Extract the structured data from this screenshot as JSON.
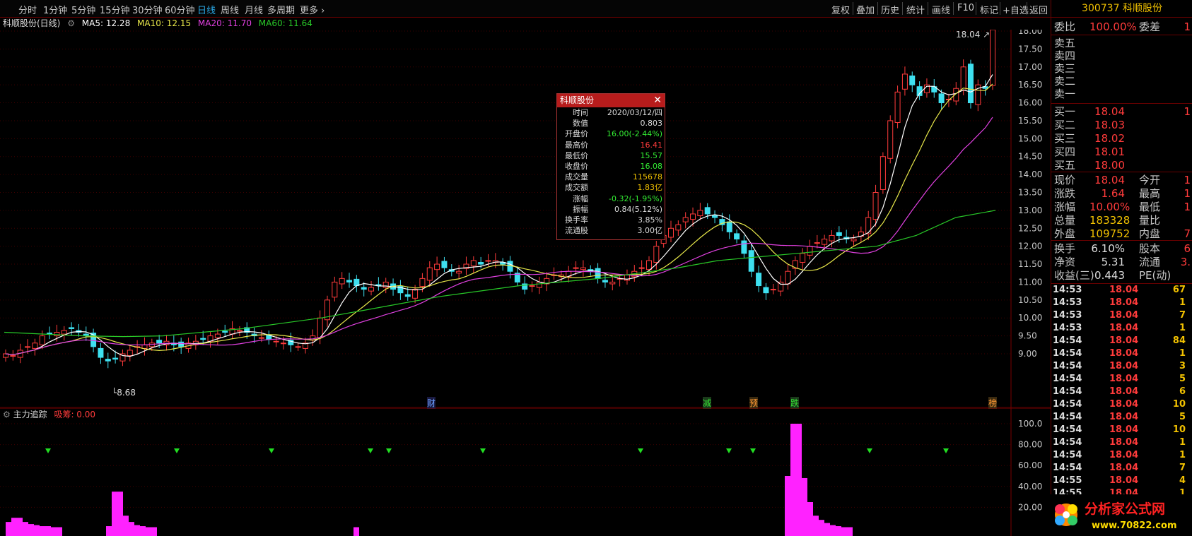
{
  "toolbar": {
    "periods": [
      "分时",
      "1分钟",
      "5分钟",
      "15分钟",
      "30分钟",
      "60分钟",
      "日线",
      "周线",
      "月线",
      "多周期",
      "更多"
    ],
    "active": "日线",
    "right_buttons": [
      "复权",
      "叠加",
      "历史",
      "统计",
      "画线",
      "F10",
      "标记",
      "+自选",
      "返回"
    ]
  },
  "info": {
    "stock": "科顺股份(日线)",
    "ma5": "MA5: 12.28",
    "ma10": "MA10: 12.15",
    "ma20": "MA20: 11.70",
    "ma60": "MA60: 11.64"
  },
  "colors": {
    "up": "#ff3b3b",
    "down": "#3ee0f0",
    "ma5": "#ffffff",
    "ma10": "#e8e84a",
    "ma20": "#e040e0",
    "ma60": "#28c828",
    "indicator": "#ff22ff",
    "signal": "#22dd22"
  },
  "price_axis": [
    "18.00",
    "17.50",
    "17.00",
    "16.50",
    "16.00",
    "15.50",
    "15.00",
    "14.50",
    "14.00",
    "13.50",
    "13.00",
    "12.50",
    "12.00",
    "11.50",
    "11.00",
    "10.50",
    "10.00",
    "9.50",
    "9.00"
  ],
  "annotations": {
    "high": "18.04",
    "low": "8.68"
  },
  "event_markers": [
    "财",
    "减",
    "预",
    "跌",
    "榜"
  ],
  "popup": {
    "title": "科顺股份",
    "rows": [
      {
        "label": "时间",
        "value": "2020/03/12/四",
        "color": "#dddddd"
      },
      {
        "label": "数值",
        "value": "0.803",
        "color": "#dddddd"
      },
      {
        "label": "开盘价",
        "value": "16.00(-2.44%)",
        "color": "#33ee33"
      },
      {
        "label": "最高价",
        "value": "16.41",
        "color": "#ff3b3b"
      },
      {
        "label": "最低价",
        "value": "15.57",
        "color": "#33ee33"
      },
      {
        "label": "收盘价",
        "value": "16.08",
        "color": "#33ee33"
      },
      {
        "label": "成交量",
        "value": "115678",
        "color": "#f0c000"
      },
      {
        "label": "成交额",
        "value": "1.83亿",
        "color": "#f0c000"
      },
      {
        "label": "涨幅",
        "value": "-0.32(-1.95%)",
        "color": "#33ee33"
      },
      {
        "label": "振幅",
        "value": "0.84(5.12%)",
        "color": "#dddddd"
      },
      {
        "label": "换手率",
        "value": "3.85%",
        "color": "#dddddd"
      },
      {
        "label": "流通股",
        "value": "3.00亿",
        "color": "#dddddd"
      }
    ]
  },
  "sub": {
    "name": "主力追踪",
    "value_label": "吸筹: 0.00",
    "axis": [
      "100.0",
      "80.00",
      "60.00",
      "40.00",
      "20.00"
    ]
  },
  "right_panel": {
    "title": "300737 科顺股份",
    "weibi": {
      "label": "委比",
      "value": "100.00%",
      "label2": "委差",
      "value2": "1"
    },
    "asks": [
      {
        "label": "卖五"
      },
      {
        "label": "卖四"
      },
      {
        "label": "卖三"
      },
      {
        "label": "卖二"
      },
      {
        "label": "卖一"
      }
    ],
    "bids": [
      {
        "label": "买一",
        "price": "18.04",
        "vol": "1"
      },
      {
        "label": "买二",
        "price": "18.03",
        "vol": ""
      },
      {
        "label": "买三",
        "price": "18.02",
        "vol": ""
      },
      {
        "label": "买四",
        "price": "18.01",
        "vol": ""
      },
      {
        "label": "买五",
        "price": "18.00",
        "vol": ""
      }
    ],
    "quote": [
      {
        "l": "现价",
        "v": "18.04",
        "l2": "今开",
        "v2": "1"
      },
      {
        "l": "涨跌",
        "v": "1.64",
        "l2": "最高",
        "v2": "1"
      },
      {
        "l": "涨幅",
        "v": "10.00%",
        "l2": "最低",
        "v2": "1"
      },
      {
        "l": "总量",
        "v": "183328",
        "l2": "量比",
        "v2": ""
      },
      {
        "l": "外盘",
        "v": "109752",
        "l2": "内盘",
        "v2": "7"
      }
    ],
    "fund": [
      {
        "l": "换手",
        "v": "6.10%",
        "l2": "股本",
        "v2": "6"
      },
      {
        "l": "净资",
        "v": "5.31",
        "l2": "流通",
        "v2": "3."
      },
      {
        "l": "收益(三)",
        "v": "0.443",
        "l2": "PE(动)",
        "v2": ""
      }
    ],
    "ticks": [
      {
        "t": "14:53",
        "p": "18.04",
        "v": "67",
        "f": "S"
      },
      {
        "t": "14:53",
        "p": "18.04",
        "v": "1",
        "f": "S"
      },
      {
        "t": "14:53",
        "p": "18.04",
        "v": "7",
        "f": "S"
      },
      {
        "t": "14:53",
        "p": "18.04",
        "v": "1",
        "f": "S"
      },
      {
        "t": "14:54",
        "p": "18.04",
        "v": "84",
        "f": "S"
      },
      {
        "t": "14:54",
        "p": "18.04",
        "v": "1",
        "f": "S"
      },
      {
        "t": "14:54",
        "p": "18.04",
        "v": "3",
        "f": "S"
      },
      {
        "t": "14:54",
        "p": "18.04",
        "v": "5",
        "f": "S"
      },
      {
        "t": "14:54",
        "p": "18.04",
        "v": "6",
        "f": "S"
      },
      {
        "t": "14:54",
        "p": "18.04",
        "v": "10",
        "f": "S"
      },
      {
        "t": "14:54",
        "p": "18.04",
        "v": "5",
        "f": "S"
      },
      {
        "t": "14:54",
        "p": "18.04",
        "v": "10",
        "f": "S"
      },
      {
        "t": "14:54",
        "p": "18.04",
        "v": "1",
        "f": "S"
      },
      {
        "t": "14:54",
        "p": "18.04",
        "v": "1",
        "f": "S"
      },
      {
        "t": "14:54",
        "p": "18.04",
        "v": "7",
        "f": "S"
      },
      {
        "t": "14:55",
        "p": "18.04",
        "v": "4",
        "f": "S"
      },
      {
        "t": "14:55",
        "p": "18.04",
        "v": "1",
        "f": "S"
      }
    ]
  },
  "watermark": {
    "text": "分析家公式网",
    "url": "www.70822.com"
  },
  "chart_data": {
    "type": "candlestick",
    "y_range": [
      8.5,
      18.1
    ],
    "close_series_approx": [
      9.0,
      8.95,
      9.1,
      9.2,
      9.3,
      9.5,
      9.55,
      9.6,
      9.65,
      9.7,
      9.6,
      9.5,
      9.2,
      8.9,
      8.8,
      8.85,
      9.0,
      9.1,
      9.2,
      9.25,
      9.3,
      9.3,
      9.35,
      9.25,
      9.2,
      9.3,
      9.35,
      9.4,
      9.5,
      9.55,
      9.6,
      9.7,
      9.65,
      9.6,
      9.5,
      9.45,
      9.4,
      9.35,
      9.3,
      9.25,
      9.2,
      9.3,
      9.5,
      10.0,
      10.5,
      11.0,
      11.1,
      11.0,
      10.9,
      10.8,
      10.85,
      10.9,
      11.0,
      10.8,
      10.7,
      10.6,
      10.8,
      11.1,
      11.4,
      11.5,
      11.4,
      11.3,
      11.3,
      11.5,
      11.6,
      11.5,
      11.6,
      11.6,
      11.5,
      11.3,
      11.0,
      10.8,
      10.9,
      11.0,
      11.1,
      11.2,
      11.2,
      11.3,
      11.4,
      11.4,
      11.3,
      11.1,
      11.0,
      11.0,
      11.1,
      11.2,
      11.3,
      11.4,
      11.6,
      12.0,
      12.3,
      12.5,
      12.6,
      12.8,
      12.9,
      13.0,
      12.9,
      12.8,
      12.6,
      12.4,
      12.2,
      11.8,
      11.3,
      10.9,
      10.7,
      10.8,
      11.0,
      11.3,
      11.6,
      11.8,
      12.0,
      12.1,
      12.2,
      12.3,
      12.3,
      12.2,
      12.2,
      12.4,
      12.8,
      13.5,
      14.5,
      15.5,
      16.3,
      16.8,
      16.5,
      16.2,
      16.5,
      16.3,
      16.0,
      16.1,
      16.4,
      17.0,
      16.0,
      16.5,
      16.4,
      18.04
    ],
    "ma60_approx": [
      9.6,
      9.55,
      9.5,
      9.48,
      9.5,
      9.6,
      9.7,
      9.85,
      10.0,
      10.2,
      10.4,
      10.6,
      10.75,
      10.9,
      11.0,
      11.1,
      11.25,
      11.4,
      11.6,
      11.7,
      11.8,
      11.9,
      12.0,
      12.3,
      12.8,
      13.0
    ]
  }
}
